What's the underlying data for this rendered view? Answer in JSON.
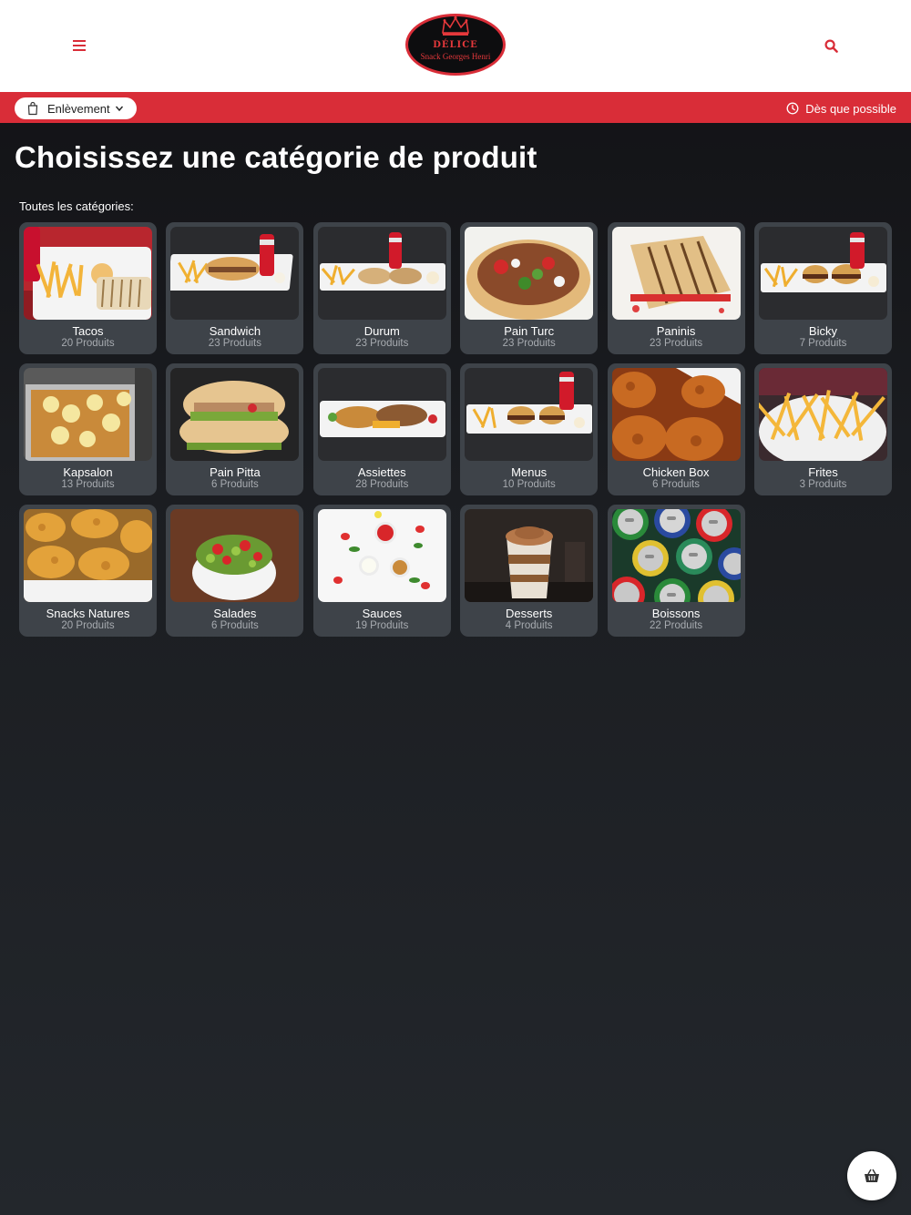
{
  "header": {
    "logo_line1": "DÉLICE",
    "logo_line2": "Snack Georges Henri",
    "menu_icon": "hamburger-icon",
    "search_icon": "search-icon"
  },
  "order_bar": {
    "mode_label": "Enlèvement",
    "time_label": "Dès que possible"
  },
  "page_title": "Choisissez une catégorie de produit",
  "section_label": "Toutes les catégories:",
  "categories": [
    {
      "name": "Tacos",
      "count": "20 Produits"
    },
    {
      "name": "Sandwich",
      "count": "23 Produits"
    },
    {
      "name": "Durum",
      "count": "23 Produits"
    },
    {
      "name": "Pain Turc",
      "count": "23 Produits"
    },
    {
      "name": "Paninis",
      "count": "23 Produits"
    },
    {
      "name": "Bicky",
      "count": "7 Produits"
    },
    {
      "name": "Kapsalon",
      "count": "13 Produits"
    },
    {
      "name": "Pain Pitta",
      "count": "6 Produits"
    },
    {
      "name": "Assiettes",
      "count": "28 Produits"
    },
    {
      "name": "Menus",
      "count": "10 Produits"
    },
    {
      "name": "Chicken Box",
      "count": "6 Produits"
    },
    {
      "name": "Frites",
      "count": "3 Produits"
    },
    {
      "name": "Snacks Natures",
      "count": "20 Produits"
    },
    {
      "name": "Salades",
      "count": "6 Produits"
    },
    {
      "name": "Sauces",
      "count": "19 Produits"
    },
    {
      "name": "Desserts",
      "count": "4 Produits"
    },
    {
      "name": "Boissons",
      "count": "22 Produits"
    }
  ],
  "colors": {
    "accent": "#d92d38",
    "card_bg": "#3e4349",
    "page_bg": "#1b1d21"
  },
  "cart_icon": "basket-icon"
}
